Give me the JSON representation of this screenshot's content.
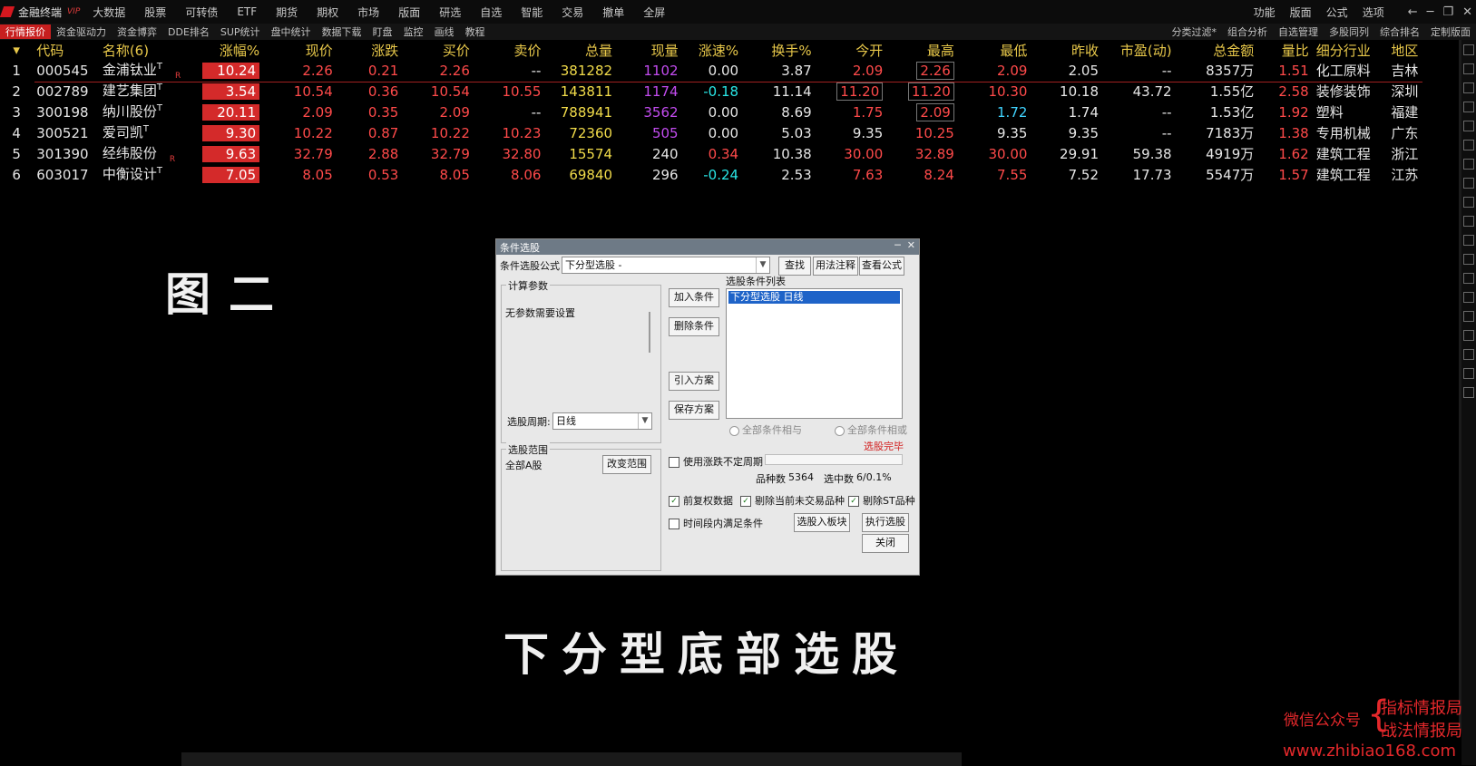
{
  "app": {
    "name": "金融终端",
    "tag": "VIP"
  },
  "menu": [
    "大数据",
    "股票",
    "可转债",
    "ETF",
    "期货",
    "期权",
    "市场",
    "版面",
    "研选",
    "自选",
    "智能",
    "交易",
    "撤单",
    "全屏"
  ],
  "menu_right": [
    "功能",
    "版面",
    "公式",
    "选项"
  ],
  "window_buttons": [
    "←",
    "─",
    "❐",
    "✕"
  ],
  "toolbar": [
    "行情报价",
    "资金驱动力",
    "资金博弈",
    "DDE排名",
    "SUP统计",
    "盘中统计",
    "数据下载",
    "盯盘",
    "监控",
    "画线",
    "教程"
  ],
  "toolbar_right": [
    "分类过滤*",
    "组合分析",
    "自选管理",
    "多股同列",
    "综合排名",
    "定制版面"
  ],
  "table": {
    "headers": [
      "代码",
      "名称(6)",
      "涨幅%",
      "现价",
      "涨跌",
      "买价",
      "卖价",
      "总量",
      "现量",
      "涨速%",
      "换手%",
      "今开",
      "最高",
      "最低",
      "昨收",
      "市盈(动)",
      "总金额",
      "量比",
      "细分行业",
      "地区"
    ],
    "question": "?",
    "rows": [
      {
        "idx": "1",
        "code": "000545",
        "name": "金浦钛业",
        "tag": "T",
        "r": "R",
        "pct": "10.24",
        "price": "2.26",
        "chg": "0.21",
        "bid": "2.26",
        "ask": "--",
        "vol": "381282",
        "cur": "1102",
        "speed": "0.00",
        "turn": "3.87",
        "open": "2.09",
        "high": "2.26",
        "low": "2.09",
        "prev": "2.05",
        "pe": "--",
        "amt": "8357万",
        "vr": "1.51",
        "ind": "化工原料",
        "area": "吉林"
      },
      {
        "idx": "2",
        "code": "002789",
        "name": "建艺集团",
        "tag": "T",
        "r": "",
        "pct": "3.54",
        "price": "10.54",
        "chg": "0.36",
        "bid": "10.54",
        "ask": "10.55",
        "vol": "143811",
        "cur": "1174",
        "speed": "-0.18",
        "turn": "11.14",
        "open": "11.20",
        "high": "11.20",
        "low": "10.30",
        "prev": "10.18",
        "pe": "43.72",
        "amt": "1.55亿",
        "vr": "2.58",
        "ind": "装修装饰",
        "area": "深圳"
      },
      {
        "idx": "3",
        "code": "300198",
        "name": "纳川股份",
        "tag": "T",
        "r": "",
        "pct": "20.11",
        "price": "2.09",
        "chg": "0.35",
        "bid": "2.09",
        "ask": "--",
        "vol": "788941",
        "cur": "3562",
        "speed": "0.00",
        "turn": "8.69",
        "open": "1.75",
        "high": "2.09",
        "low": "1.72",
        "prev": "1.74",
        "pe": "--",
        "amt": "1.53亿",
        "vr": "1.92",
        "ind": "塑料",
        "area": "福建"
      },
      {
        "idx": "4",
        "code": "300521",
        "name": "爱司凯",
        "tag": "T",
        "r": "",
        "pct": "9.30",
        "price": "10.22",
        "chg": "0.87",
        "bid": "10.22",
        "ask": "10.23",
        "vol": "72360",
        "cur": "505",
        "speed": "0.00",
        "turn": "5.03",
        "open": "9.35",
        "high": "10.25",
        "low": "9.35",
        "prev": "9.35",
        "pe": "--",
        "amt": "7183万",
        "vr": "1.38",
        "ind": "专用机械",
        "area": "广东"
      },
      {
        "idx": "5",
        "code": "301390",
        "name": "经纬股份",
        "tag": "",
        "r": "R",
        "pct": "9.63",
        "price": "32.79",
        "chg": "2.88",
        "bid": "32.79",
        "ask": "32.80",
        "vol": "15574",
        "cur": "240",
        "speed": "0.34",
        "turn": "10.38",
        "open": "30.00",
        "high": "32.89",
        "low": "30.00",
        "prev": "29.91",
        "pe": "59.38",
        "amt": "4919万",
        "vr": "1.62",
        "ind": "建筑工程",
        "area": "浙江"
      },
      {
        "idx": "6",
        "code": "603017",
        "name": "中衡设计",
        "tag": "T",
        "r": "",
        "pct": "7.05",
        "price": "8.05",
        "chg": "0.53",
        "bid": "8.05",
        "ask": "8.06",
        "vol": "69840",
        "cur": "296",
        "speed": "-0.24",
        "turn": "2.53",
        "open": "7.63",
        "high": "8.24",
        "low": "7.55",
        "prev": "7.52",
        "pe": "17.73",
        "amt": "5547万",
        "vr": "1.57",
        "ind": "建筑工程",
        "area": "江苏"
      }
    ]
  },
  "captions": {
    "figure": "图二",
    "title": "下分型底部选股"
  },
  "dialog": {
    "title": "条件选股",
    "formula_label": "条件选股公式",
    "formula_value": "下分型选股  -",
    "btn_find": "查找",
    "btn_usage": "用法注释",
    "btn_view": "查看公式",
    "params_title": "计算参数",
    "params_text": "无参数需要设置",
    "period_label": "选股周期:",
    "period_value": "日线",
    "range_title": "选股范围",
    "range_value": "全部A股",
    "btn_range": "改变范围",
    "btn_add": "加入条件",
    "btn_delete": "删除条件",
    "btn_import": "引入方案",
    "btn_save": "保存方案",
    "list_title": "选股条件列表",
    "list_item": "下分型选股  日线",
    "radio_and": "全部条件相与",
    "radio_or": "全部条件相或",
    "status": "选股完毕",
    "chk_unfixed": "使用涨跌不定周期",
    "count_label": "品种数",
    "count_value": "5364",
    "selected_label": "选中数",
    "selected_value": "6/0.1%",
    "chk_forward": "前复权数据",
    "chk_exclude_suspended": "剔除当前未交易品种",
    "chk_exclude_st": "剔除ST品种",
    "chk_period": "时间段内满足条件",
    "btn_to_block": "选股入板块",
    "btn_execute": "执行选股",
    "btn_close": "关闭"
  },
  "watermark": {
    "label": "微信公众号",
    "line1": "指标情报局",
    "line2": "战法情报局",
    "url": "www.zhibiao168.com"
  }
}
